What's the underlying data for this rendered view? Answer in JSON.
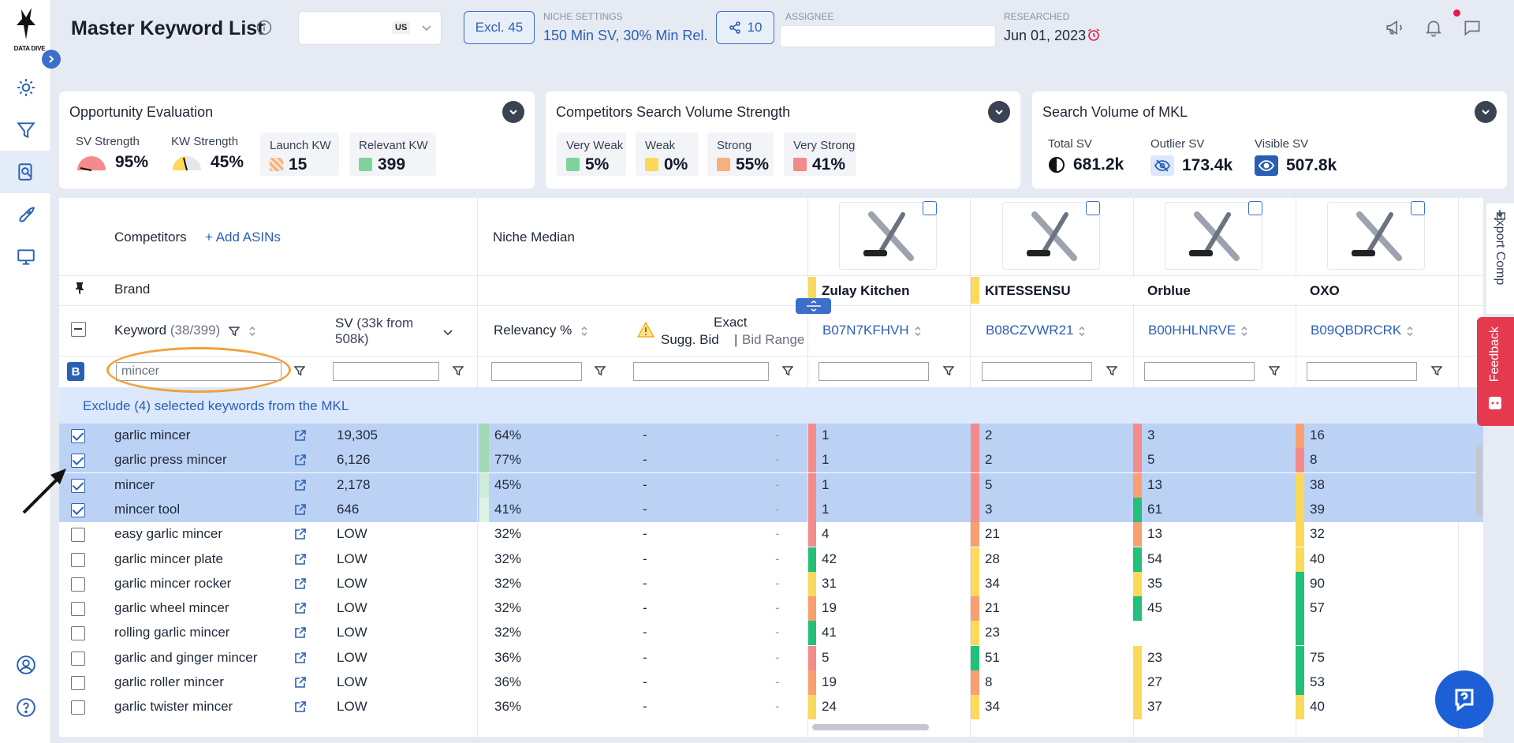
{
  "header": {
    "title": "Master Keyword List",
    "market": "US",
    "excl_label": "Excl. 45",
    "niche_label": "NICHE SETTINGS",
    "niche_value": "150 Min SV, 30% Min Rel.",
    "share_count": "10",
    "assignee_label": "ASSIGNEE",
    "researched_label": "RESEARCHED",
    "researched_date": "Jun 01, 2023"
  },
  "sidebar": {
    "logo_text": "DATA DIVE",
    "items": [
      "lightbulb-icon",
      "funnel-icon",
      "search-doc-icon",
      "rocket-icon",
      "monitor-icon"
    ],
    "bottom": [
      "user-icon",
      "help-icon"
    ]
  },
  "cards": {
    "opportunity": {
      "title": "Opportunity Evaluation",
      "sv_label": "SV Strength",
      "sv_value": "95%",
      "kw_label": "KW Strength",
      "kw_value": "45%",
      "launch_label": "Launch KW",
      "launch_value": "15",
      "relevant_label": "Relevant KW",
      "relevant_value": "399"
    },
    "competitors": {
      "title": "Competitors Search Volume Strength",
      "items": [
        {
          "label": "Very Weak",
          "value": "5%",
          "color": "#7fd39a"
        },
        {
          "label": "Weak",
          "value": "0%",
          "color": "#fbd95a"
        },
        {
          "label": "Strong",
          "value": "55%",
          "color": "#f8b07a"
        },
        {
          "label": "Very Strong",
          "value": "41%",
          "color": "#f48b8b"
        }
      ]
    },
    "search_volume": {
      "title": "Search Volume of MKL",
      "total_label": "Total SV",
      "total_value": "681.2k",
      "outlier_label": "Outlier SV",
      "outlier_value": "173.4k",
      "visible_label": "Visible SV",
      "visible_value": "507.8k"
    }
  },
  "table": {
    "competitors_label": "Competitors",
    "add_asins": "+ Add ASINs",
    "niche_median": "Niche Median",
    "brand_label": "Brand",
    "col_keyword": "Keyword",
    "col_keyword_count": "(38/399)",
    "col_sv": "SV",
    "col_sv_sub": "(33k from 508k)",
    "col_relevancy": "Relevancy %",
    "col_exact": "Exact",
    "col_sugg_bid": "Sugg. Bid",
    "col_bid_range": "Bid Range",
    "filter_value": "mincer",
    "bulk_badge": "B",
    "exclude_text": "Exclude (4) selected keywords from the MKL",
    "export_label": "Export Comp",
    "feedback_label": "Feedback",
    "competitors": [
      {
        "brand": "Zulay Kitchen",
        "asin": "B07N7KFHVH",
        "color": "#fbd95a"
      },
      {
        "brand": "KITESSENSU",
        "asin": "B08CZVWR21",
        "color": "#fbd95a"
      },
      {
        "brand": "Orblue",
        "asin": "B00HHLNRVE",
        "color": "#ffffff"
      },
      {
        "brand": "OXO",
        "asin": "B09QBDRCRK",
        "color": "#ffffff"
      }
    ],
    "rows": [
      {
        "kw": "garlic mincer",
        "sv": "19,305",
        "rel": "64%",
        "bid": "-",
        "range": "-",
        "sel": true,
        "rel_color": "#9fd8b3",
        "ranks": [
          [
            "1",
            "#f48b8b"
          ],
          [
            "2",
            "#f48b8b"
          ],
          [
            "3",
            "#f48b8b"
          ],
          [
            "16",
            "#f8a070"
          ]
        ]
      },
      {
        "kw": "garlic press mincer",
        "sv": "6,126",
        "rel": "77%",
        "bid": "-",
        "range": "-",
        "sel": true,
        "rel_color": "#9fd8b3",
        "ranks": [
          [
            "1",
            "#f48b8b"
          ],
          [
            "2",
            "#f48b8b"
          ],
          [
            "5",
            "#f48b8b"
          ],
          [
            "8",
            "#f48b8b"
          ]
        ]
      },
      {
        "kw": "mincer",
        "sv": "2,178",
        "rel": "45%",
        "bid": "-",
        "range": "-",
        "sel": true,
        "rel_color": "#cfecd9",
        "ranks": [
          [
            "1",
            "#f48b8b"
          ],
          [
            "5",
            "#f48b8b"
          ],
          [
            "13",
            "#f8a070"
          ],
          [
            "38",
            "#fbd95a"
          ]
        ]
      },
      {
        "kw": "mincer tool",
        "sv": "646",
        "rel": "41%",
        "bid": "-",
        "range": "-",
        "sel": true,
        "rel_color": "#dff2e6",
        "ranks": [
          [
            "1",
            "#f48b8b"
          ],
          [
            "3",
            "#f48b8b"
          ],
          [
            "61",
            "#22c07a"
          ],
          [
            "39",
            "#fbd95a"
          ]
        ]
      },
      {
        "kw": "easy garlic mincer",
        "sv": "LOW",
        "rel": "32%",
        "bid": "-",
        "range": "-",
        "sel": false,
        "rel_color": "#ffffff",
        "ranks": [
          [
            "4",
            "#f48b8b"
          ],
          [
            "21",
            "#f8a070"
          ],
          [
            "13",
            "#f8a070"
          ],
          [
            "32",
            "#fbd95a"
          ]
        ]
      },
      {
        "kw": "garlic mincer plate",
        "sv": "LOW",
        "rel": "32%",
        "bid": "-",
        "range": "-",
        "sel": false,
        "rel_color": "#ffffff",
        "ranks": [
          [
            "42",
            "#22c07a"
          ],
          [
            "28",
            "#fbd95a"
          ],
          [
            "54",
            "#22c07a"
          ],
          [
            "40",
            "#fbd95a"
          ]
        ]
      },
      {
        "kw": "garlic mincer rocker",
        "sv": "LOW",
        "rel": "32%",
        "bid": "-",
        "range": "-",
        "sel": false,
        "rel_color": "#ffffff",
        "ranks": [
          [
            "31",
            "#fbd95a"
          ],
          [
            "34",
            "#fbd95a"
          ],
          [
            "35",
            "#fbd95a"
          ],
          [
            "90",
            "#22c07a"
          ]
        ]
      },
      {
        "kw": "garlic wheel mincer",
        "sv": "LOW",
        "rel": "32%",
        "bid": "-",
        "range": "-",
        "sel": false,
        "rel_color": "#ffffff",
        "ranks": [
          [
            "19",
            "#f8a070"
          ],
          [
            "21",
            "#f8a070"
          ],
          [
            "45",
            "#22c07a"
          ],
          [
            "57",
            "#22c07a"
          ]
        ]
      },
      {
        "kw": "rolling garlic mincer",
        "sv": "LOW",
        "rel": "32%",
        "bid": "-",
        "range": "-",
        "sel": false,
        "rel_color": "#ffffff",
        "ranks": [
          [
            "41",
            "#22c07a"
          ],
          [
            "23",
            "#fbd95a"
          ],
          [
            "",
            "#ffffff"
          ],
          [
            "",
            "#22c07a"
          ]
        ]
      },
      {
        "kw": "garlic and ginger mincer",
        "sv": "LOW",
        "rel": "36%",
        "bid": "-",
        "range": "-",
        "sel": false,
        "rel_color": "#ffffff",
        "ranks": [
          [
            "5",
            "#f48b8b"
          ],
          [
            "51",
            "#22c07a"
          ],
          [
            "23",
            "#fbd95a"
          ],
          [
            "75",
            "#22c07a"
          ]
        ]
      },
      {
        "kw": "garlic roller mincer",
        "sv": "LOW",
        "rel": "36%",
        "bid": "-",
        "range": "-",
        "sel": false,
        "rel_color": "#ffffff",
        "ranks": [
          [
            "19",
            "#f8a070"
          ],
          [
            "8",
            "#f8a070"
          ],
          [
            "27",
            "#fbd95a"
          ],
          [
            "53",
            "#22c07a"
          ]
        ]
      },
      {
        "kw": "garlic twister mincer",
        "sv": "LOW",
        "rel": "36%",
        "bid": "-",
        "range": "-",
        "sel": false,
        "rel_color": "#ffffff",
        "ranks": [
          [
            "24",
            "#fbd95a"
          ],
          [
            "34",
            "#fbd95a"
          ],
          [
            "37",
            "#fbd95a"
          ],
          [
            "40",
            "#fbd95a"
          ]
        ]
      }
    ]
  }
}
